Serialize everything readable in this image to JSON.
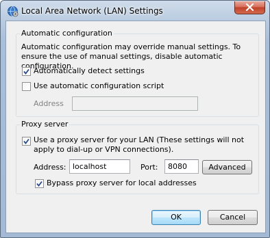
{
  "window": {
    "title": "Local Area Network (LAN) Settings",
    "close_glyph": "✕"
  },
  "auto_config": {
    "group_title": "Automatic configuration",
    "description": "Automatic configuration may override manual settings.  To ensure the use of manual settings, disable automatic configuration.",
    "detect_label": "Automatically detect settings",
    "detect_checked": true,
    "script_label": "Use automatic configuration script",
    "script_checked": false,
    "address_label": "Address",
    "address_value": ""
  },
  "proxy": {
    "group_title": "Proxy server",
    "use_proxy_label": "Use a proxy server for your LAN (These settings will not apply to dial-up or VPN connections).",
    "use_proxy_checked": true,
    "address_label": "Address:",
    "address_value": "localhost",
    "port_label": "Port:",
    "port_value": "8080",
    "advanced_label": "Advanced",
    "bypass_label": "Bypass proxy server for local addresses",
    "bypass_checked": true
  },
  "footer": {
    "ok_label": "OK",
    "cancel_label": "Cancel"
  },
  "colors": {
    "titlebar": "#b9cbe0",
    "dialog_bg": "#f0f0f0",
    "close_button": "#c0412a",
    "default_button_border": "#3c7fb1",
    "checkmark": "#2a4a8a"
  },
  "icons": [
    "network-settings-icon",
    "close-icon",
    "checkmark-icon"
  ]
}
